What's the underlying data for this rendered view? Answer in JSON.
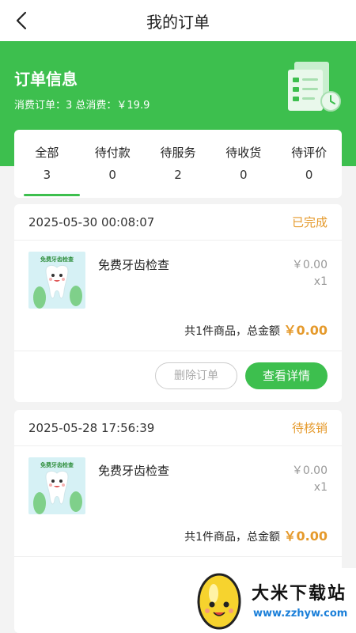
{
  "nav": {
    "title": "我的订单"
  },
  "banner": {
    "title": "订单信息",
    "summary": "消费订单：3 总消费：￥19.9"
  },
  "tabs": [
    {
      "label": "全部",
      "count": "3",
      "active": true
    },
    {
      "label": "待付款",
      "count": "0"
    },
    {
      "label": "待服务",
      "count": "2"
    },
    {
      "label": "待收货",
      "count": "0"
    },
    {
      "label": "待评价",
      "count": "0"
    }
  ],
  "orders": [
    {
      "time": "2025-05-30 00:08:07",
      "status": "已完成",
      "thumb_text": "免费牙齿检查",
      "item_name": "免费牙齿检查",
      "price": "￥0.00",
      "qty": "x1",
      "total_prefix": "共1件商品，总金额",
      "total_amount": "￥0.00",
      "delete_label": "删除订单",
      "detail_label": "查看详情"
    },
    {
      "time": "2025-05-28 17:56:39",
      "status": "待核销",
      "thumb_text": "免费牙齿检查",
      "item_name": "免费牙齿检查",
      "price": "￥0.00",
      "qty": "x1",
      "total_prefix": "共1件商品，总金额",
      "total_amount": "￥0.00"
    }
  ],
  "watermark": {
    "name": "大米下载站",
    "url": "www.zzhyw.com"
  },
  "colors": {
    "accent": "#3dbf4e",
    "status": "#e59a2c"
  },
  "icons": [
    "back-arrow-icon",
    "order-document-icon",
    "clock-icon",
    "tooth-mascot-icon",
    "rice-logo-icon"
  ]
}
